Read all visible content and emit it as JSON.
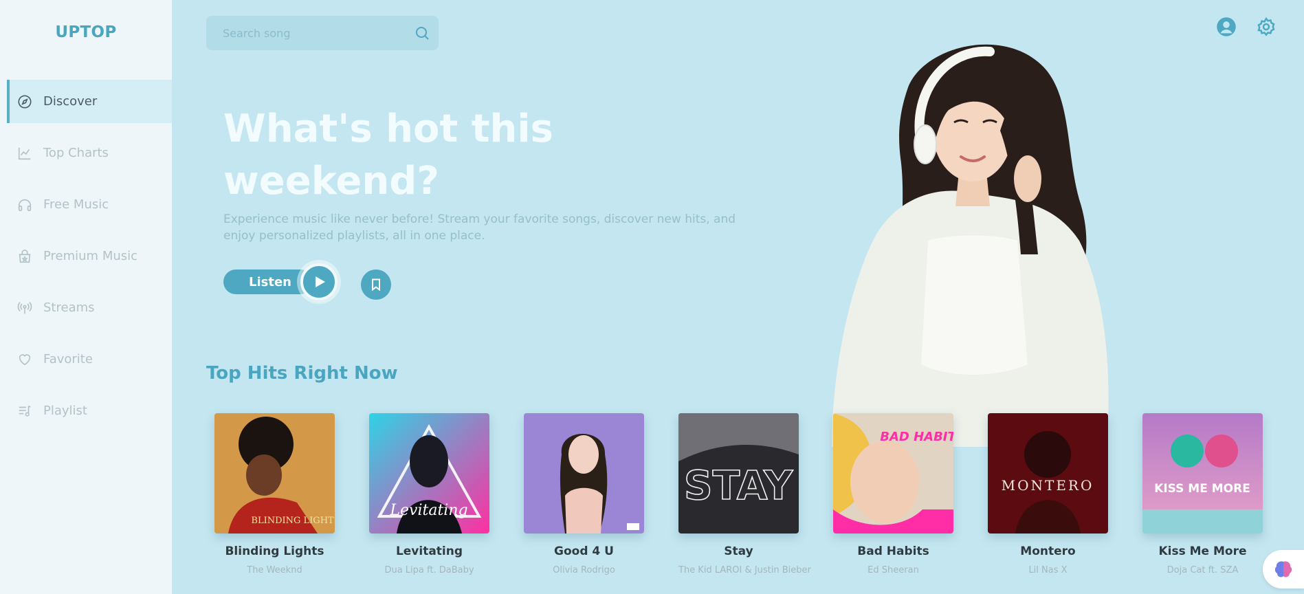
{
  "app": {
    "logo": "UPTOP"
  },
  "sidebar": {
    "items": [
      {
        "label": "Discover",
        "icon": "compass-icon",
        "active": true
      },
      {
        "label": "Top Charts",
        "icon": "chart-line-icon",
        "active": false
      },
      {
        "label": "Free Music",
        "icon": "headphones-icon",
        "active": false
      },
      {
        "label": "Premium Music",
        "icon": "premium-bag-icon",
        "active": false
      },
      {
        "label": "Streams",
        "icon": "broadcast-icon",
        "active": false
      },
      {
        "label": "Favorite",
        "icon": "heart-icon",
        "active": false
      },
      {
        "label": "Playlist",
        "icon": "playlist-icon",
        "active": false
      }
    ]
  },
  "search": {
    "placeholder": "Search song",
    "icon": "search-icon"
  },
  "header_icons": [
    "user-icon",
    "gear-icon"
  ],
  "hero": {
    "title": "What's hot this weekend?",
    "description": "Experience music like never before! Stream your favorite songs, discover new hits, and enjoy personalized playlists, all in one place.",
    "listen_label": "Listen",
    "play_icon": "play-icon",
    "bookmark_icon": "bookmark-icon"
  },
  "section": {
    "title": "Top Hits Right Now"
  },
  "songs": [
    {
      "title": "Blinding Lights",
      "artist": "The Weeknd",
      "cover_text": "BLINDING LIGHTS"
    },
    {
      "title": "Levitating",
      "artist": "Dua Lipa ft. DaBaby",
      "cover_text": "Levitating"
    },
    {
      "title": "Good 4 U",
      "artist": "Olivia Rodrigo",
      "cover_text": ""
    },
    {
      "title": "Stay",
      "artist": "The Kid LAROI & Justin Bieber",
      "cover_text": "STAY"
    },
    {
      "title": "Bad Habits",
      "artist": "Ed Sheeran",
      "cover_text": "BAD HABITS"
    },
    {
      "title": "Montero",
      "artist": "Lil Nas X",
      "cover_text": "MONTERO"
    },
    {
      "title": "Kiss Me More",
      "artist": "Doja Cat ft. SZA",
      "cover_text": "KISS ME MORE"
    }
  ],
  "colors": {
    "accent": "#4ea8c2",
    "background": "#c4e6f0",
    "sidebar": "#eef6f9"
  }
}
